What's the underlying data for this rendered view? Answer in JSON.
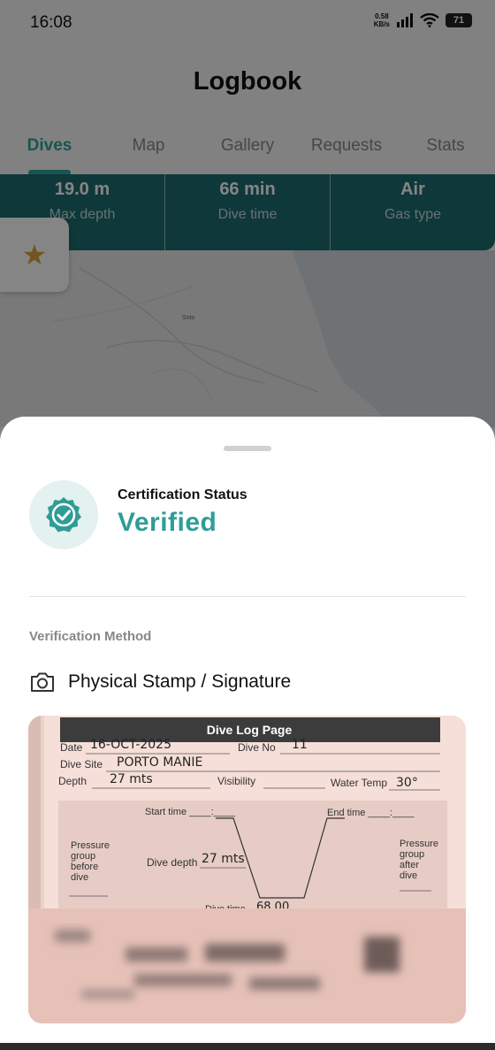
{
  "status_bar": {
    "time": "16:08",
    "net_speed_value": "0.58",
    "net_speed_unit": "KB/s",
    "battery": "71"
  },
  "header": {
    "title": "Logbook"
  },
  "tabs": [
    {
      "label": "Dives",
      "active": true
    },
    {
      "label": "Map"
    },
    {
      "label": "Gallery"
    },
    {
      "label": "Requests"
    },
    {
      "label": "Stats"
    }
  ],
  "dive_stats": [
    {
      "value": "19.0 m",
      "label": "Max depth"
    },
    {
      "value": "66 min",
      "label": "Dive time"
    },
    {
      "value": "Air",
      "label": "Gas type"
    }
  ],
  "map": {
    "place_label_1": "Soto"
  },
  "sheet": {
    "cert_label": "Certification Status",
    "cert_value": "Verified",
    "method_heading": "Verification Method",
    "method_label": "Physical Stamp / Signature",
    "method_icon": "camera-icon",
    "badge_icon": "verified-badge-icon"
  },
  "log_page": {
    "title": "Dive Log Page",
    "date_label": "Date",
    "date_value": "16-OCT-2025",
    "dive_no_label": "Dive No",
    "dive_no_value": "11",
    "dive_site_label": "Dive Site",
    "dive_site_value": "PORTO MANIE",
    "depth_label": "Depth",
    "depth_value": "27 mts",
    "visibility_label": "Visibility",
    "water_temp_label": "Water Temp",
    "water_temp_value": "30°",
    "start_time_label": "Start time ____:____",
    "end_time_label": "End time ____:____",
    "pressure_before_l1": "Pressure",
    "pressure_before_l2": "group",
    "pressure_before_l3": "before",
    "pressure_before_l4": "dive",
    "pressure_after_l1": "Pressure",
    "pressure_after_l2": "group",
    "pressure_after_l3": "after",
    "pressure_after_l4": "dive",
    "dive_depth_label": "Dive depth",
    "dive_depth_value": "27 mts",
    "dive_time_label": "Dive time",
    "dive_time_value": "68.00"
  },
  "colors": {
    "accent": "#2ea39b",
    "stats_card": "#1d6b70",
    "verified_text": "#2f9d96"
  }
}
